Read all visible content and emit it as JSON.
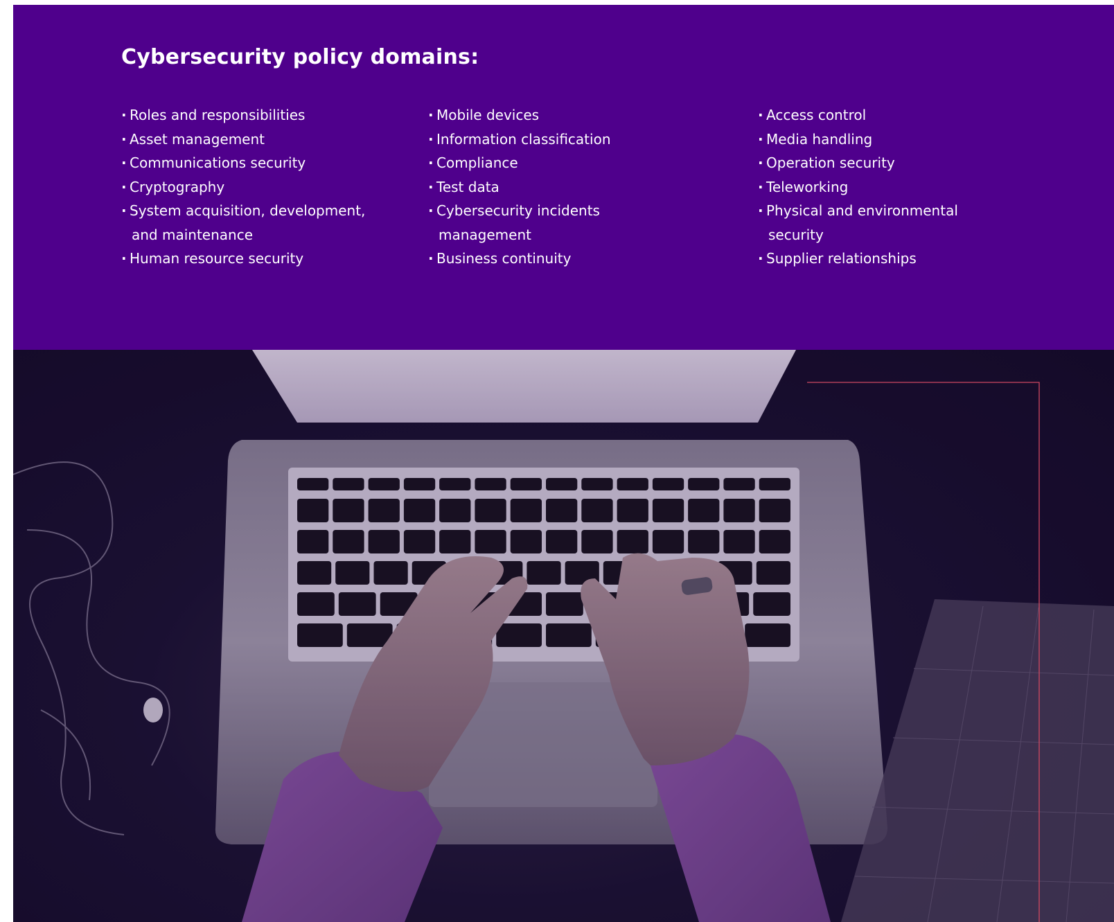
{
  "title": "Cybersecurity policy domains:",
  "columns": [
    [
      "Roles and responsibilities",
      "Asset management",
      "Communications security",
      "Cryptography",
      "System acquisition, development,|and maintenance",
      "Human resource security"
    ],
    [
      "Mobile devices",
      "Information classification",
      "Compliance",
      "Test data",
      "Cybersecurity incidents|management",
      "Business continuity"
    ],
    [
      "Access control",
      "Media handling",
      "Operation security",
      "Teleworking",
      "Physical and environmental|security",
      "Supplier relationships"
    ]
  ],
  "colors": {
    "panel": "#4f008c",
    "frame_line": "#ff5a6a"
  },
  "image": {
    "subject": "hands-typing-on-laptop-photo"
  }
}
